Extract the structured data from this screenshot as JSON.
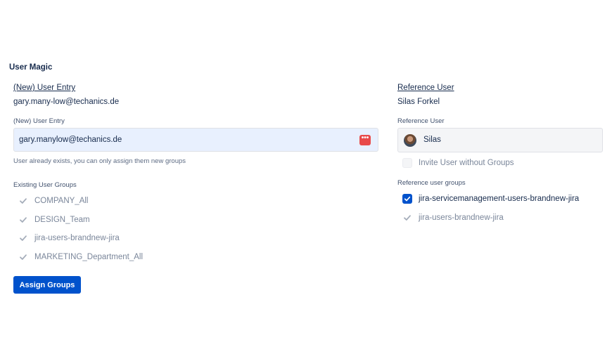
{
  "app": {
    "title": "User Magic"
  },
  "left": {
    "heading": "(New) User Entry",
    "heading_value": "gary.many-low@techanics.de",
    "field_label": "(New) User Entry",
    "field_value": "gary.manylow@techanics.de",
    "field_icon": "password-manager-icon",
    "helper": "User already exists, you can only assign them new groups",
    "groups_label": "Existing User Groups",
    "groups": [
      {
        "label": "COMPANY_All",
        "checked": true,
        "disabled": true
      },
      {
        "label": "DESIGN_Team",
        "checked": true,
        "disabled": true
      },
      {
        "label": "jira-users-brandnew-jira",
        "checked": true,
        "disabled": true
      },
      {
        "label": "MARKETING_Department_All",
        "checked": true,
        "disabled": true
      }
    ],
    "button_label": "Assign Groups"
  },
  "right": {
    "heading": "Reference User",
    "heading_value": "Silas Forkel",
    "field_label": "Reference User",
    "selected_user": "Silas",
    "invite_label": "Invite User without Groups",
    "groups_label": "Reference user groups",
    "groups": [
      {
        "label": "jira-servicemanagement-users-brandnew-jira",
        "checked": true,
        "disabled": false
      },
      {
        "label": "jira-users-brandnew-jira",
        "checked": true,
        "disabled": true
      }
    ]
  },
  "colors": {
    "primary": "#0052cc",
    "text": "#172b4d",
    "muted": "#7a869a",
    "input_bg": "#e8f0fe"
  }
}
